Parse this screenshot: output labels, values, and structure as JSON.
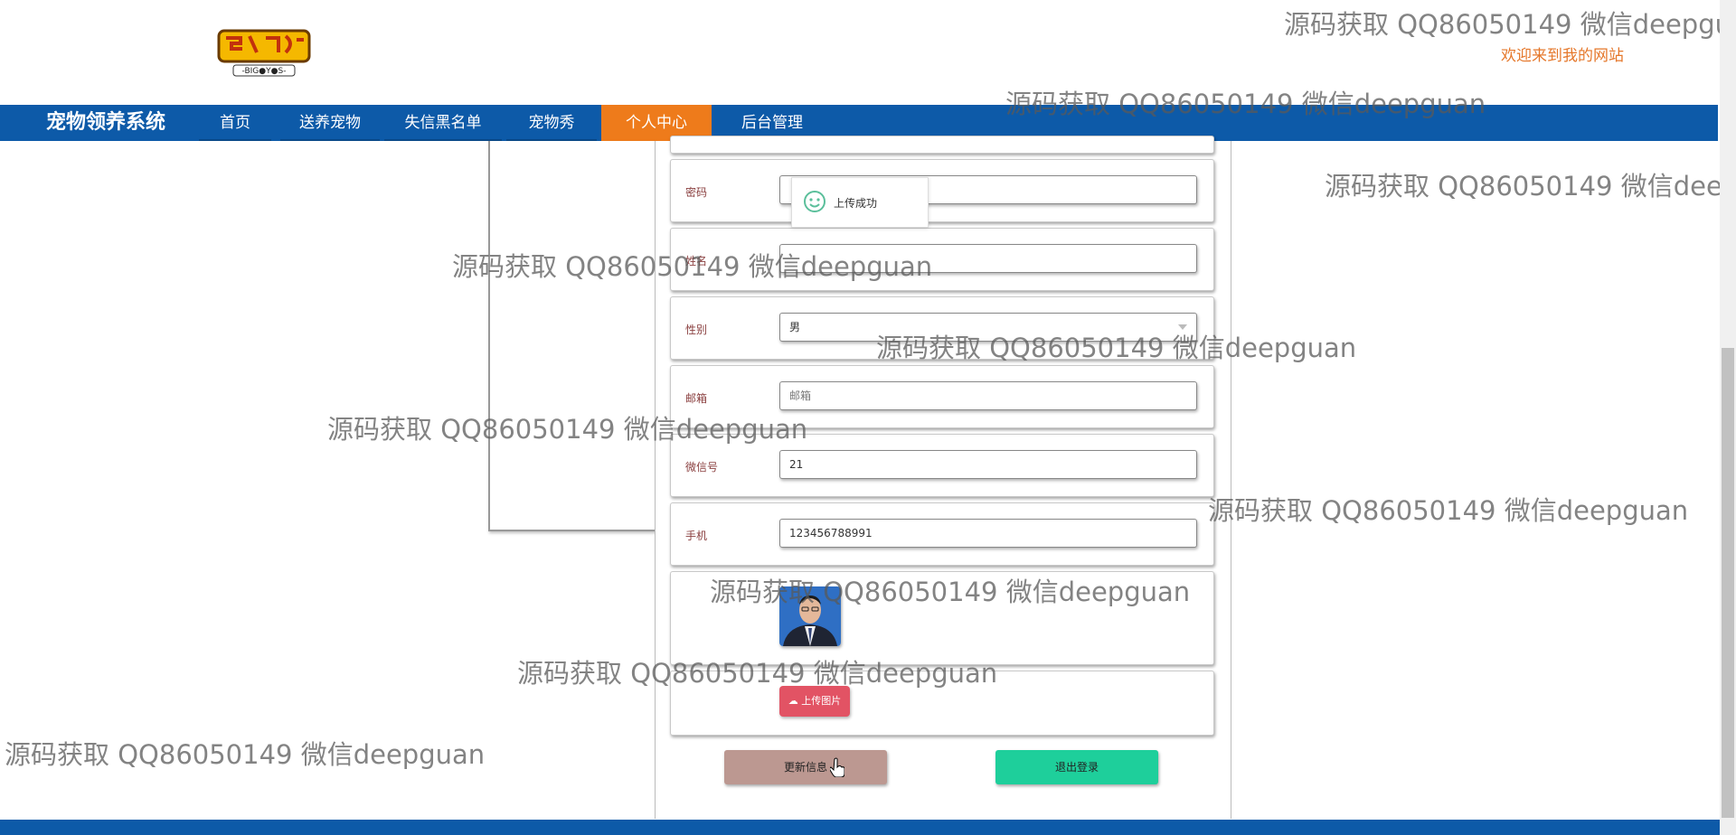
{
  "header": {
    "logo_alt": "BIGBOYS",
    "welcome": "欢迎来到我的网站"
  },
  "nav": {
    "brand": "宠物领养系统",
    "items": [
      {
        "label": "首页",
        "active": false
      },
      {
        "label": "送养宠物",
        "active": false
      },
      {
        "label": "失信黑名单",
        "active": false
      },
      {
        "label": "宠物秀",
        "active": false
      },
      {
        "label": "个人中心",
        "active": true
      },
      {
        "label": "后台管理",
        "active": false
      }
    ]
  },
  "form": {
    "password_label": "密码",
    "password_value": "",
    "name_label": "姓名",
    "name_value": "",
    "gender_label": "性别",
    "gender_value": "男",
    "email_label": "邮箱",
    "email_placeholder": "邮箱",
    "wechat_label": "微信号",
    "wechat_value": "21",
    "phone_label": "手机",
    "phone_value": "123456788991",
    "upload_label": "上传图片",
    "update_button": "更新信息",
    "logout_button": "退出登录"
  },
  "toast": {
    "text": "上传成功"
  },
  "watermark": {
    "text": "源码获取 QQ86050149 微信deepguan",
    "text_cut1": "源码获取 QQ86050149 微信deepgu",
    "text_cut2": "源码获取 QQ86050149 微信deep"
  },
  "colors": {
    "nav_bg": "#0d5aa8",
    "nav_active": "#ee7b1b",
    "welcome": "#e5772a",
    "update_btn": "#bc9891",
    "logout_btn": "#1ecf9b",
    "upload_btn": "#e25364"
  }
}
